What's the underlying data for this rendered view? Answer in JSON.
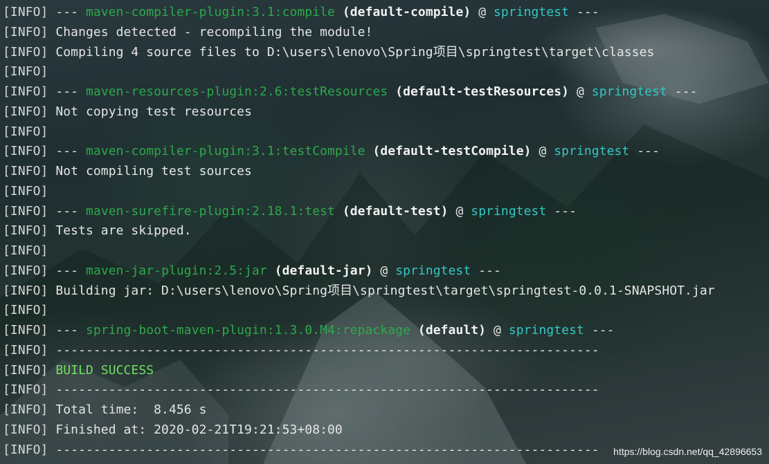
{
  "colors": {
    "text": "#e6e6e6",
    "plugin": "#2ea84a",
    "goal": "#f2f2f2",
    "project": "#33c7c4",
    "success": "#6fe05e"
  },
  "lines": [
    {
      "tag": "[INFO]",
      "sep": " --- ",
      "plugin": "maven-compiler-plugin:3.1:compile",
      "goal": "(default-compile)",
      "at": " @ ",
      "project": "springtest",
      "end": " ---"
    },
    {
      "tag": "[INFO]",
      "text": " Changes detected - recompiling the module!"
    },
    {
      "tag": "[INFO]",
      "text": " Compiling 4 source files to D:\\users\\lenovo\\Spring项目\\springtest\\target\\classes"
    },
    {
      "tag": "[INFO]",
      "text": ""
    },
    {
      "tag": "[INFO]",
      "sep": " --- ",
      "plugin": "maven-resources-plugin:2.6:testResources",
      "goal": "(default-testResources)",
      "at": " @ ",
      "project": "springtest",
      "end": " ---"
    },
    {
      "tag": "[INFO]",
      "text": " Not copying test resources"
    },
    {
      "tag": "[INFO]",
      "text": ""
    },
    {
      "tag": "[INFO]",
      "sep": " --- ",
      "plugin": "maven-compiler-plugin:3.1:testCompile",
      "goal": "(default-testCompile)",
      "at": " @ ",
      "project": "springtest",
      "end": " ---"
    },
    {
      "tag": "[INFO]",
      "text": " Not compiling test sources"
    },
    {
      "tag": "[INFO]",
      "text": ""
    },
    {
      "tag": "[INFO]",
      "sep": " --- ",
      "plugin": "maven-surefire-plugin:2.18.1:test",
      "goal": "(default-test)",
      "at": " @ ",
      "project": "springtest",
      "end": " ---"
    },
    {
      "tag": "[INFO]",
      "text": " Tests are skipped."
    },
    {
      "tag": "[INFO]",
      "text": ""
    },
    {
      "tag": "[INFO]",
      "sep": " --- ",
      "plugin": "maven-jar-plugin:2.5:jar",
      "goal": "(default-jar)",
      "at": " @ ",
      "project": "springtest",
      "end": " ---"
    },
    {
      "tag": "[INFO]",
      "text": " Building jar: D:\\users\\lenovo\\Spring项目\\springtest\\target\\springtest-0.0.1-SNAPSHOT.jar"
    },
    {
      "tag": "[INFO]",
      "text": ""
    },
    {
      "tag": "[INFO]",
      "sep": " --- ",
      "plugin": "spring-boot-maven-plugin:1.3.0.M4:repackage",
      "goal": "(default)",
      "at": " @ ",
      "project": "springtest",
      "end": " ---"
    },
    {
      "tag": "[INFO]",
      "text": " ------------------------------------------------------------------------"
    },
    {
      "tag": "[INFO]",
      "sp": " ",
      "success": "BUILD SUCCESS"
    },
    {
      "tag": "[INFO]",
      "text": " ------------------------------------------------------------------------"
    },
    {
      "tag": "[INFO]",
      "text": " Total time:  8.456 s"
    },
    {
      "tag": "[INFO]",
      "text": " Finished at: 2020-02-21T19:21:53+08:00"
    },
    {
      "tag": "[INFO]",
      "text": " ------------------------------------------------------------------------"
    }
  ],
  "watermark": "https://blog.csdn.net/qq_42896653"
}
